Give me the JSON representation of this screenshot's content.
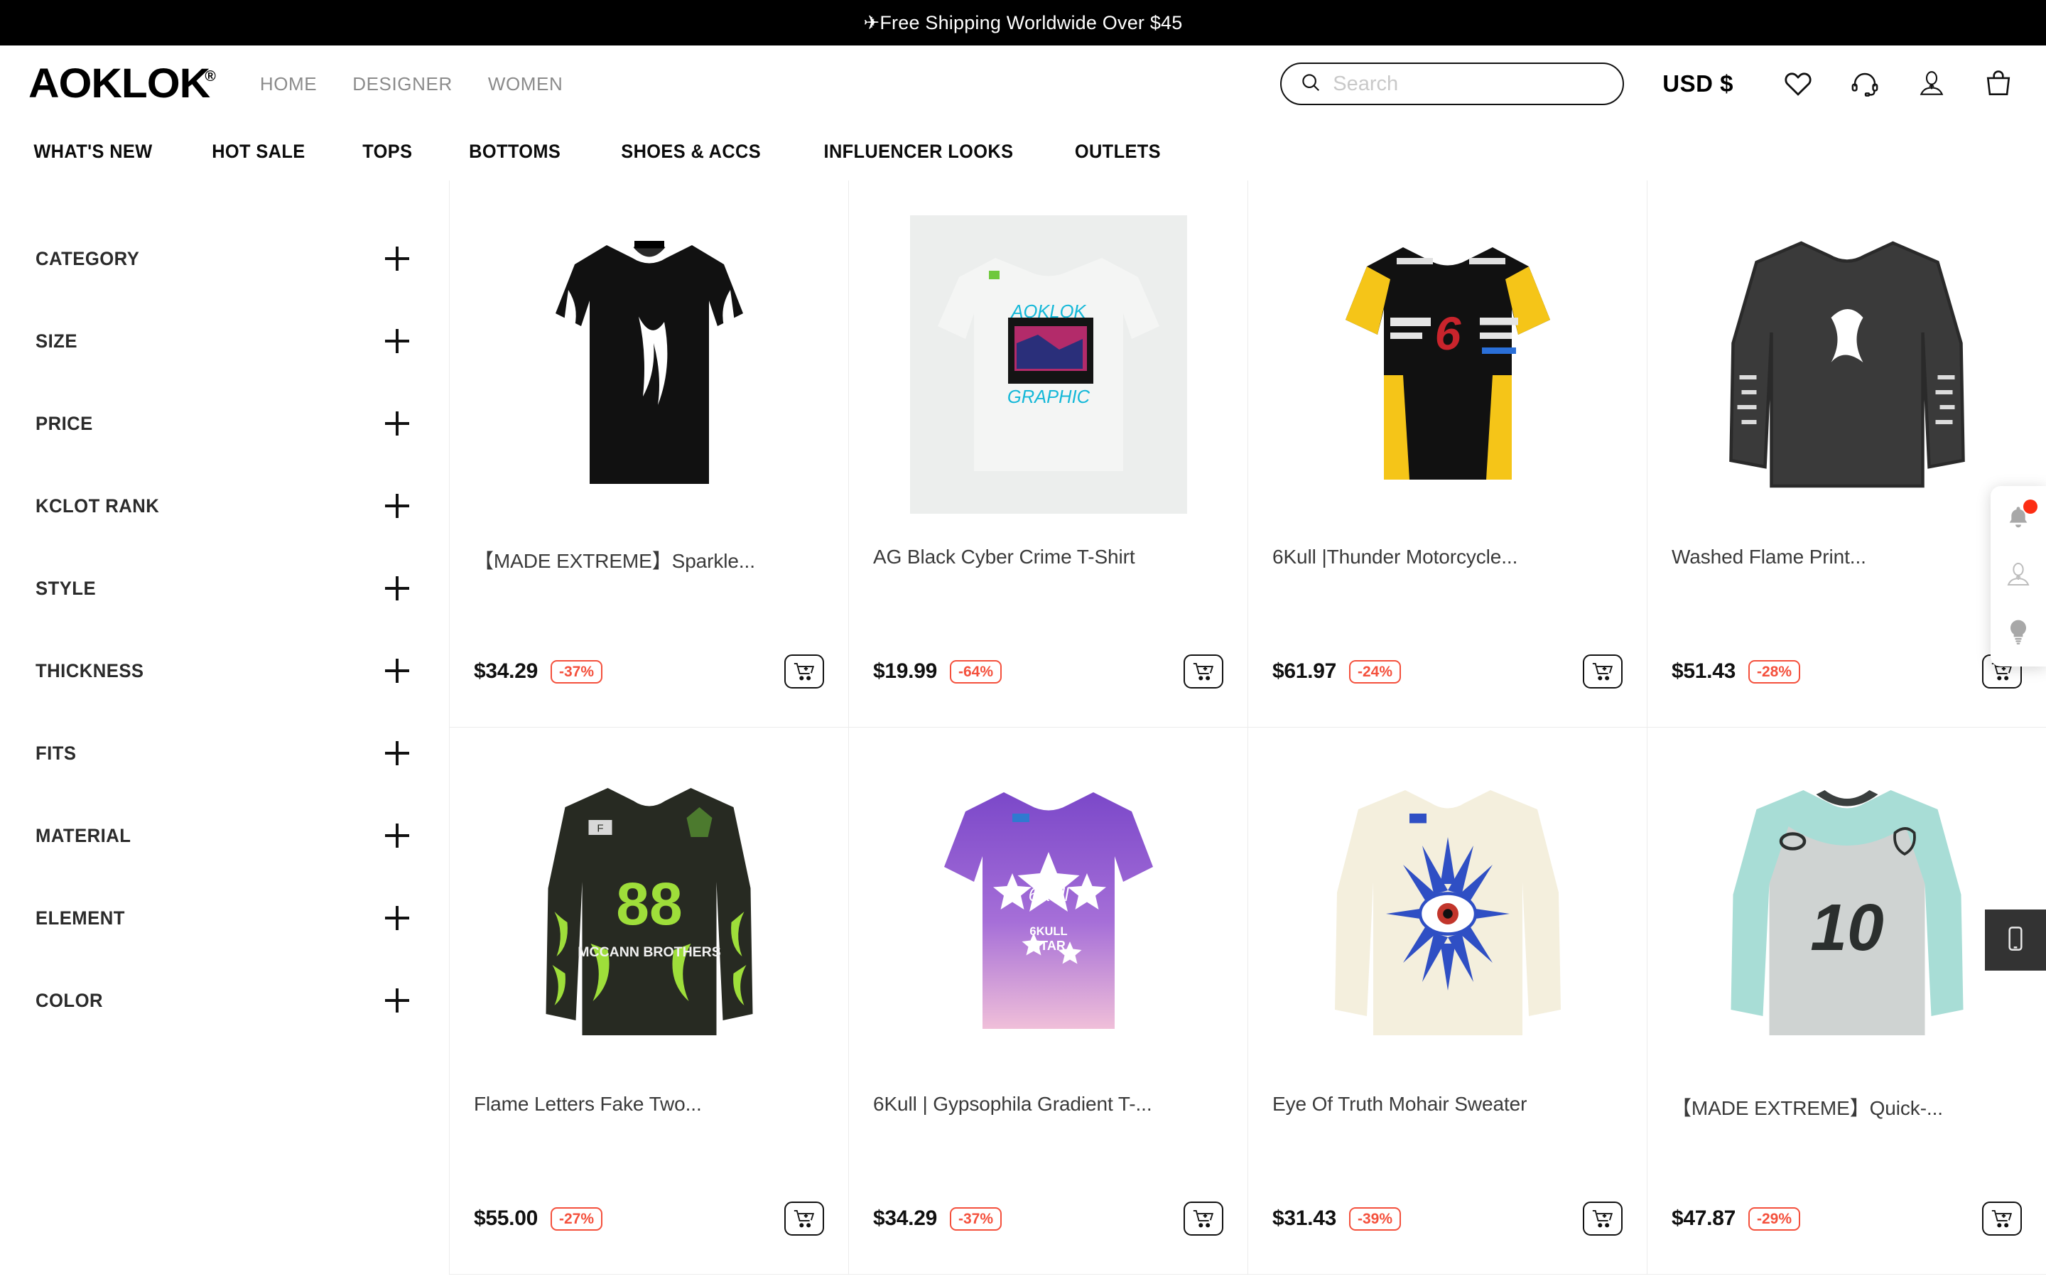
{
  "announcement": {
    "icon": "airplane-icon",
    "text": "✈Free Shipping Worldwide Over $45"
  },
  "header": {
    "logo": "AOKLOK",
    "logo_mark": "®",
    "nav": [
      {
        "label": "HOME"
      },
      {
        "label": "DESIGNER"
      },
      {
        "label": "WOMEN"
      }
    ],
    "search": {
      "placeholder": "Search",
      "value": "",
      "icon": "search-icon"
    },
    "currency": "USD $",
    "icons": [
      {
        "name": "heart-icon",
        "label": "Wishlist"
      },
      {
        "name": "headset-icon",
        "label": "Support"
      },
      {
        "name": "user-icon",
        "label": "Account"
      },
      {
        "name": "shopping-bag-icon",
        "label": "Cart"
      }
    ]
  },
  "main_nav": [
    {
      "label": "WHAT'S NEW"
    },
    {
      "label": "HOT SALE"
    },
    {
      "label": "TOPS"
    },
    {
      "label": "BOTTOMS"
    },
    {
      "label": "SHOES & ACCS"
    },
    {
      "label": "INFLUENCER LOOKS"
    },
    {
      "label": "OUTLETS"
    }
  ],
  "sidebar": {
    "filters": [
      {
        "label": "CATEGORY",
        "expanded": false
      },
      {
        "label": "SIZE",
        "expanded": false
      },
      {
        "label": "PRICE",
        "expanded": false
      },
      {
        "label": "KCLOT RANK",
        "expanded": false
      },
      {
        "label": "STYLE",
        "expanded": false
      },
      {
        "label": "THICKNESS",
        "expanded": false
      },
      {
        "label": "FITS",
        "expanded": false
      },
      {
        "label": "MATERIAL",
        "expanded": false
      },
      {
        "label": "ELEMENT",
        "expanded": false
      },
      {
        "label": "COLOR",
        "expanded": false
      }
    ]
  },
  "products": [
    {
      "title": "【MADE EXTREME】Sparkle...",
      "price": "$34.29",
      "discount": "-37%",
      "cart_icon": "add-to-cart-icon"
    },
    {
      "title": "AG Black Cyber Crime T-Shirt",
      "price": "$19.99",
      "discount": "-64%",
      "cart_icon": "add-to-cart-icon"
    },
    {
      "title": "6Kull |Thunder Motorcycle...",
      "price": "$61.97",
      "discount": "-24%",
      "cart_icon": "add-to-cart-icon"
    },
    {
      "title": "Washed Flame Print...",
      "price": "$51.43",
      "discount": "-28%",
      "cart_icon": "add-to-cart-icon"
    },
    {
      "title": "Flame Letters Fake Two...",
      "price": "$55.00",
      "discount": "-27%",
      "cart_icon": "add-to-cart-icon"
    },
    {
      "title": "6Kull | Gypsophila Gradient T-...",
      "price": "$34.29",
      "discount": "-37%",
      "cart_icon": "add-to-cart-icon"
    },
    {
      "title": "Eye Of Truth Mohair Sweater",
      "price": "$31.43",
      "discount": "-39%",
      "cart_icon": "add-to-cart-icon"
    },
    {
      "title": "【MADE EXTREME】Quick-...",
      "price": "$47.87",
      "discount": "-29%",
      "cart_icon": "add-to-cart-icon"
    }
  ],
  "floating": {
    "side_widgets": [
      {
        "name": "bell-icon",
        "has_badge": true
      },
      {
        "name": "user-icon",
        "has_badge": false
      },
      {
        "name": "lightbulb-icon",
        "has_badge": false
      }
    ],
    "mobile_button": {
      "name": "mobile-phone-icon"
    }
  },
  "colors": {
    "accent_red": "#f4503c",
    "badge_red": "#fc2d13",
    "nav_gray": "#8b8b8b",
    "border": "#ececec"
  }
}
